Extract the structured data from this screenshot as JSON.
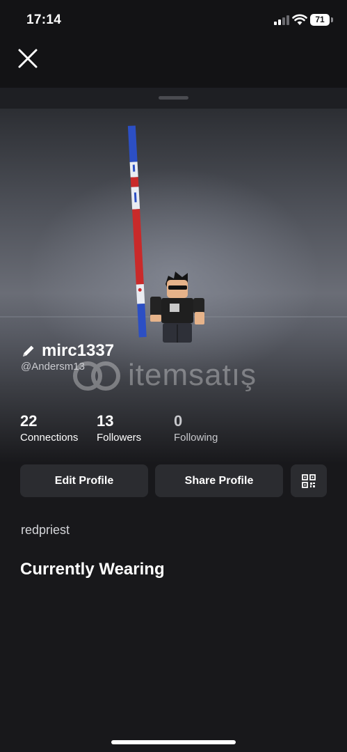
{
  "status_bar": {
    "time": "17:14",
    "battery_level": "71"
  },
  "profile": {
    "display_name": "mirc1337",
    "handle": "@Andersm13",
    "bio": "redpriest"
  },
  "watermark": {
    "text": "itemsatış"
  },
  "stats": [
    {
      "value": "22",
      "label": "Connections"
    },
    {
      "value": "13",
      "label": "Followers"
    },
    {
      "value": "0",
      "label": "Following"
    }
  ],
  "actions": {
    "edit_label": "Edit Profile",
    "share_label": "Share Profile"
  },
  "sections": {
    "wearing_title": "Currently Wearing"
  },
  "icons": {
    "close": "close-icon",
    "edit": "pencil-icon",
    "qr": "qr-code-icon",
    "signal": "cellular-signal-icon",
    "wifi": "wifi-icon",
    "battery": "battery-icon"
  },
  "colors": {
    "background": "#18181b",
    "button": "#2b2c30",
    "text_primary": "#ffffff",
    "text_secondary": "#c9cacf"
  }
}
